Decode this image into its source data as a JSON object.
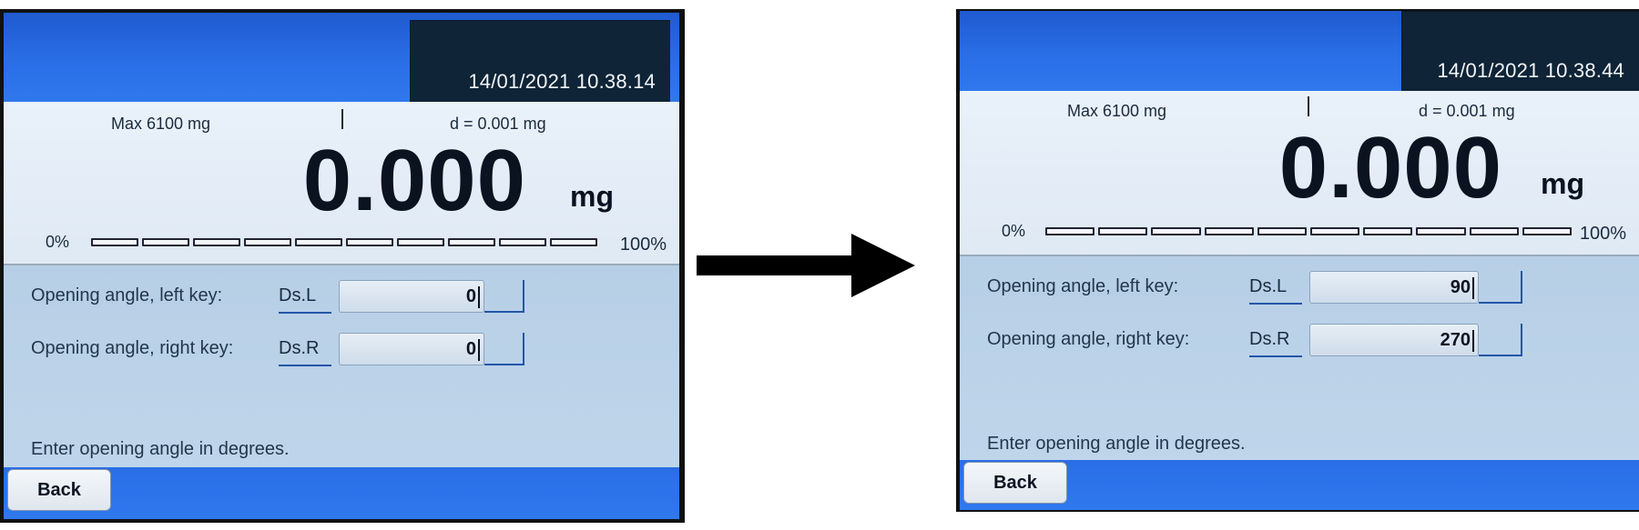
{
  "screens": {
    "before": {
      "datetime": "14/01/2021 10.38.14",
      "max_label": "Max 6100 mg",
      "d_label": "d = 0.001 mg",
      "weight": "0.000",
      "unit": "mg",
      "bar_min_label": "0%",
      "bar_max_label": "100%",
      "bar_fill_fraction": 0,
      "rows": [
        {
          "label": "Opening angle, left key:",
          "code": "Ds.L",
          "value": "0"
        },
        {
          "label": "Opening angle, right key:",
          "code": "Ds.R",
          "value": "0"
        }
      ],
      "hint": "Enter opening angle in degrees.",
      "back_label": "Back"
    },
    "after": {
      "datetime": "14/01/2021 10.38.44",
      "max_label": "Max 6100 mg",
      "d_label": "d = 0.001 mg",
      "weight": "0.000",
      "unit": "mg",
      "bar_min_label": "0%",
      "bar_max_label": "100%",
      "bar_fill_fraction": 0,
      "rows": [
        {
          "label": "Opening angle, left key:",
          "code": "Ds.L",
          "value": "90"
        },
        {
          "label": "Opening angle, right key:",
          "code": "Ds.R",
          "value": "270"
        }
      ],
      "hint": "Enter opening angle in degrees.",
      "back_label": "Back"
    }
  },
  "arrow_icon": "right-arrow-icon",
  "colors": {
    "topbar_blue": "#2a6ee6",
    "clock_bg": "#0f2436",
    "panel_bg": "#bcd4ea",
    "link_blue": "#2356a8"
  }
}
